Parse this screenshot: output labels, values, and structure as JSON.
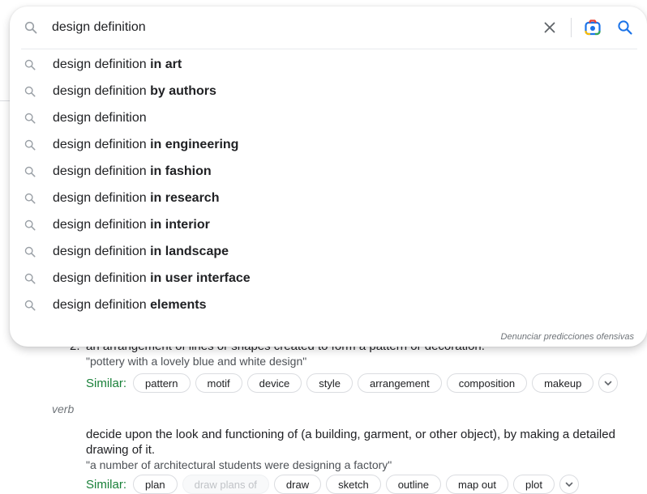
{
  "search": {
    "query": "design definition",
    "placeholder": ""
  },
  "suggestions": [
    {
      "prefix": "design definition",
      "completion": "in art"
    },
    {
      "prefix": "design definition",
      "completion": "by authors"
    },
    {
      "prefix": "design definition",
      "completion": ""
    },
    {
      "prefix": "design definition",
      "completion": "in engineering"
    },
    {
      "prefix": "design definition",
      "completion": "in fashion"
    },
    {
      "prefix": "design definition",
      "completion": "in research"
    },
    {
      "prefix": "design definition",
      "completion": "in interior"
    },
    {
      "prefix": "design definition",
      "completion": "in landscape"
    },
    {
      "prefix": "design definition",
      "completion": "in user interface"
    },
    {
      "prefix": "design definition",
      "completion": "elements"
    }
  ],
  "report_predictions": "Denunciar predicciones ofensivas",
  "dictionary": {
    "sense2": {
      "number": "2.",
      "definition": "an arrangement of lines or shapes created to form a pattern or decoration.",
      "example": "\"pottery with a lovely blue and white design\"",
      "similar_label": "Similar:",
      "similar": [
        "pattern",
        "motif",
        "device",
        "style",
        "arrangement",
        "composition",
        "makeup"
      ]
    },
    "verb_label": "verb",
    "verb_sense": {
      "definition": "decide upon the look and functioning of (a building, garment, or other object), by making a detailed drawing of it.",
      "example": "\"a number of architectural students were designing a factory\"",
      "similar_label": "Similar:",
      "similar": [
        "plan",
        "draw plans of",
        "draw",
        "sketch",
        "outline",
        "map out",
        "plot"
      ]
    }
  },
  "colors": {
    "similar_label": "#188038",
    "lens_blue": "#1a73e8",
    "lens_red": "#ea4335",
    "lens_yellow": "#fbbc04",
    "lens_green": "#34a853"
  }
}
